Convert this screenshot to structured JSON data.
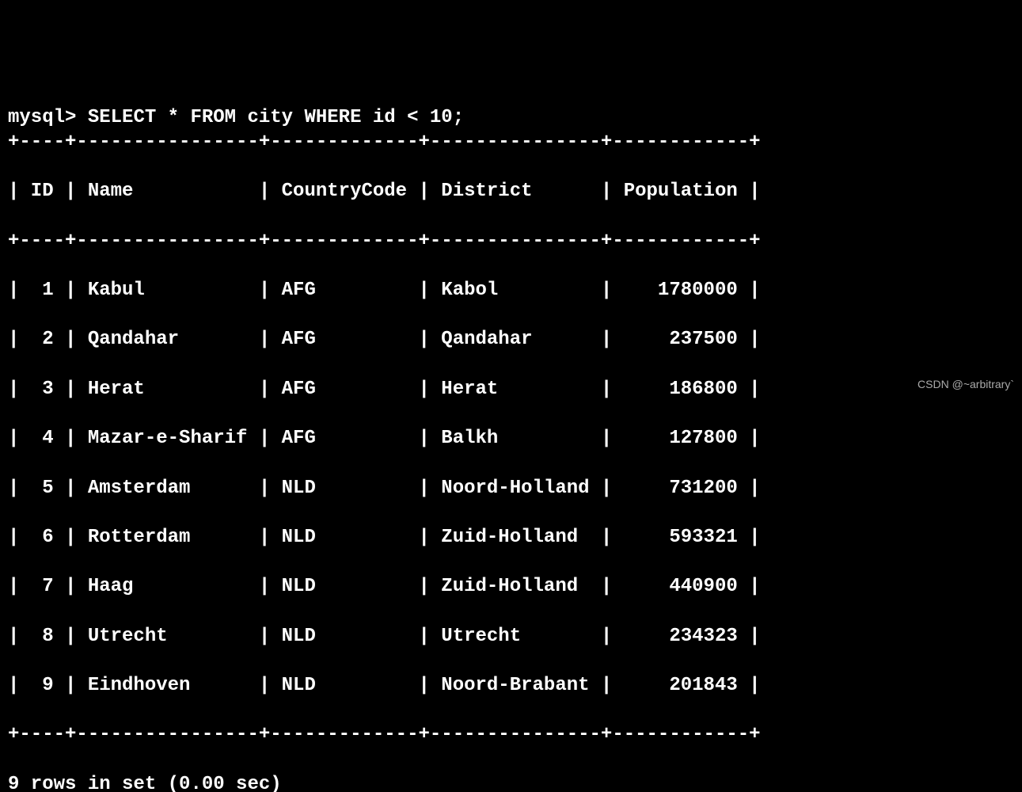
{
  "prompt": "mysql> ",
  "query": "SELECT * FROM city WHERE id < 10;",
  "separator": "+----+----------------+-------------+---------------+------------+",
  "header": "| ID | Name           | CountryCode | District      | Population |",
  "chart_data": {
    "type": "table",
    "columns": [
      "ID",
      "Name",
      "CountryCode",
      "District",
      "Population"
    ],
    "rows": [
      {
        "ID": 1,
        "Name": "Kabul",
        "CountryCode": "AFG",
        "District": "Kabol",
        "Population": 1780000
      },
      {
        "ID": 2,
        "Name": "Qandahar",
        "CountryCode": "AFG",
        "District": "Qandahar",
        "Population": 237500
      },
      {
        "ID": 3,
        "Name": "Herat",
        "CountryCode": "AFG",
        "District": "Herat",
        "Population": 186800
      },
      {
        "ID": 4,
        "Name": "Mazar-e-Sharif",
        "CountryCode": "AFG",
        "District": "Balkh",
        "Population": 127800
      },
      {
        "ID": 5,
        "Name": "Amsterdam",
        "CountryCode": "NLD",
        "District": "Noord-Holland",
        "Population": 731200
      },
      {
        "ID": 6,
        "Name": "Rotterdam",
        "CountryCode": "NLD",
        "District": "Zuid-Holland",
        "Population": 593321
      },
      {
        "ID": 7,
        "Name": "Haag",
        "CountryCode": "NLD",
        "District": "Zuid-Holland",
        "Population": 440900
      },
      {
        "ID": 8,
        "Name": "Utrecht",
        "CountryCode": "NLD",
        "District": "Utrecht",
        "Population": 234323
      },
      {
        "ID": 9,
        "Name": "Eindhoven",
        "CountryCode": "NLD",
        "District": "Noord-Brabant",
        "Population": 201843
      }
    ]
  },
  "rows_formatted": [
    "|  1 | Kabul          | AFG         | Kabol         |    1780000 |",
    "|  2 | Qandahar       | AFG         | Qandahar      |     237500 |",
    "|  3 | Herat          | AFG         | Herat         |     186800 |",
    "|  4 | Mazar-e-Sharif | AFG         | Balkh         |     127800 |",
    "|  5 | Amsterdam      | NLD         | Noord-Holland |     731200 |",
    "|  6 | Rotterdam      | NLD         | Zuid-Holland  |     593321 |",
    "|  7 | Haag           | NLD         | Zuid-Holland  |     440900 |",
    "|  8 | Utrecht        | NLD         | Utrecht       |     234323 |",
    "|  9 | Eindhoven      | NLD         | Noord-Brabant |     201843 |"
  ],
  "status": "9 rows in set (0.00 sec)",
  "watermark": "CSDN @~arbitrary`"
}
